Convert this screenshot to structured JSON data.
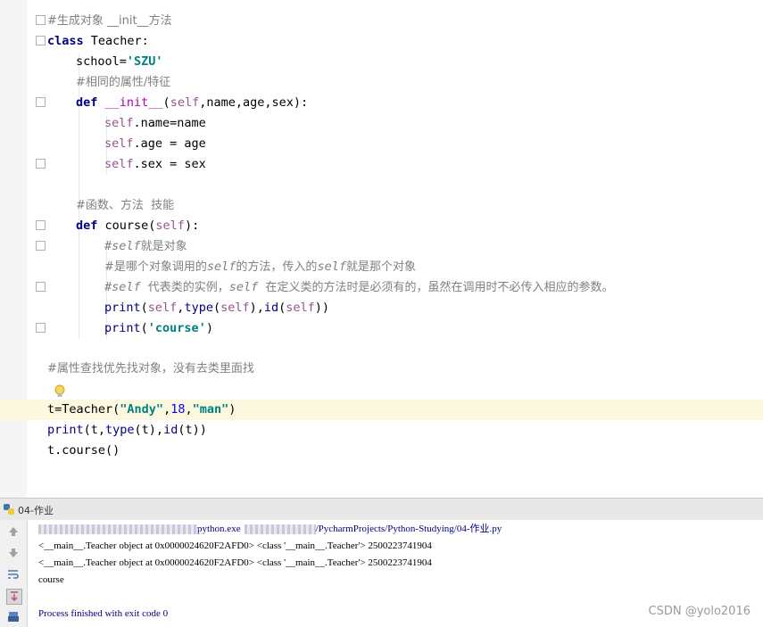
{
  "editor": {
    "lines": [
      {
        "key": "l0"
      },
      {
        "key": "l1"
      }
    ],
    "top_comment": "#生成对象 __init__方法",
    "class_kw": "class",
    "class_name": " Teacher:",
    "school_name": "school=",
    "school_value": "'SZU'",
    "comment_attr": "#相同的属性/特征",
    "def_kw": "def",
    "init_name": " __init__",
    "init_open": "(",
    "init_self": "self",
    "init_params": ",name,age,sex):",
    "self1": "self",
    "assign1": ".name=name",
    "self2": "self",
    "assign2": ".age = age",
    "self3": "self",
    "assign3": ".sex = sex",
    "comment_func": "#函数、方法  技能",
    "def_kw2": "def",
    "course_name": " course(",
    "course_self": "self",
    "course_close": "):",
    "c1_hash": "#",
    "c1_self": "self",
    "c1_rest": "就是对象",
    "c2_a": "#是哪个对象调用的",
    "c2_self": "self",
    "c2_b": "的方法，传入的",
    "c2_self2": "self",
    "c2_c": "就是那个对象",
    "c3_a": "#self ",
    "c3_b": "代表类的实例，",
    "c3_self": "self ",
    "c3_c": "在定义类的方法时是必须有的，虽然在调用时不必传入相应的参数。",
    "p1_print": "print",
    "p1_open": "(",
    "p1_self": "self",
    "p1_comma": ",",
    "p1_type": "type",
    "p1_o2": "(",
    "p1_self2": "self",
    "p1_c2": "),",
    "p1_id": "id",
    "p1_o3": "(",
    "p1_self3": "self",
    "p1_c3": "))",
    "p2_print": "print",
    "p2_open": "(",
    "p2_str": "'course'",
    "p2_close": ")",
    "comment_lookup": "#属性查找优先找对象，没有去类里面找",
    "t_assign": "t=Teacher(",
    "t_arg1": "\"Andy\"",
    "t_c1": ",",
    "t_arg2": "18",
    "t_c2": ",",
    "t_arg3": "\"man\"",
    "t_close": ")",
    "p3_print": "print",
    "p3_rest_a": "(t,",
    "p3_type": "type",
    "p3_rest_b": "(t),",
    "p3_id": "id",
    "p3_rest_c": "(t))",
    "last_line": "t.course()"
  },
  "run": {
    "tab_title": "04-作业",
    "cmd_a": "python.exe",
    "cmd_b": "/PycharmProjects/Python-Studying/04-作业.py",
    "out1": "<__main__.Teacher object at 0x0000024620F2AFD0> <class '__main__.Teacher'> 2500223741904",
    "out2": "<__main__.Teacher object at 0x0000024620F2AFD0> <class '__main__.Teacher'> 2500223741904",
    "out3": "course",
    "finished": "Process finished with exit code 0"
  },
  "watermark": "CSDN @yolo2016",
  "colors": {
    "keyword": "#000080",
    "self": "#94558d",
    "string": "#008080",
    "comment": "#808080",
    "number": "#0000ff",
    "highlight": "#fcf8e0"
  }
}
